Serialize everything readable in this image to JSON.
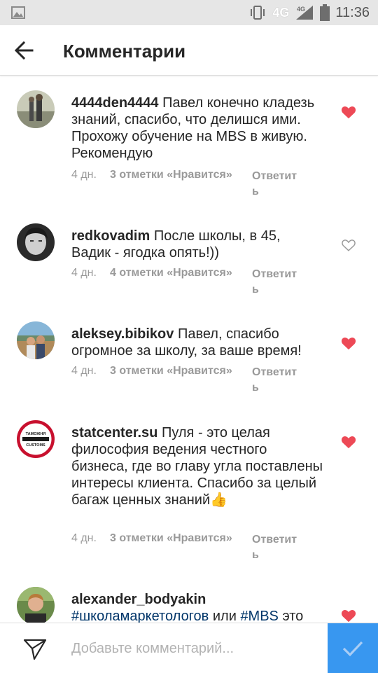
{
  "status_bar": {
    "time": "11:36",
    "network": "4G",
    "network_small": "4G"
  },
  "header": {
    "title": "Комментарии"
  },
  "comments": [
    {
      "username": "4444den4444",
      "text": " Павел конечно кладезь знаний, спасибо, что делишся ими. Прохожу обучение на MBS в живую. Рекомендую",
      "ago": "4 дн.",
      "likes": "3 отметки «Нравится»",
      "reply": "Ответить",
      "liked": true
    },
    {
      "username": "redkovadim",
      "text": " После школы, в 45, Вадик - ягодка опять!))",
      "ago": "4 дн.",
      "likes": "4 отметки «Нравится»",
      "reply": "Ответить",
      "liked": false
    },
    {
      "username": "aleksey.bibikov",
      "text": " Павел, спасибо огромное за школу, за ваше время!",
      "ago": "4 дн.",
      "likes": "3 отметки «Нравится»",
      "reply": "Ответить",
      "liked": true
    },
    {
      "username": "statcenter.su",
      "text": " Пуля - это целая философия ведения честного бизнеса, где во главу угла поставлены интересы клиента. Спасибо за целый багаж ценных знаний",
      "emoji": "👍",
      "ago": "4 дн.",
      "likes": "3 отметки «Нравится»",
      "reply": "Ответить",
      "liked": true
    },
    {
      "username": "alexander_bodyakin",
      "hashtag1": "#школамаркетологов",
      "text_mid": " или ",
      "hashtag2": "#MBS",
      "text_end": " это",
      "liked": true
    }
  ],
  "stamp_text": {
    "top": "ТАМОЖНЯ",
    "bottom": "CUSTOMS"
  },
  "composer": {
    "placeholder": "Добавьте комментарий..."
  },
  "colors": {
    "heart_active": "#ed4956",
    "heart_inactive": "#999999",
    "accent": "#3897f0",
    "hashtag": "#003569"
  },
  "icons": {
    "back": "arrow-left-icon",
    "like": "heart-icon",
    "send": "paper-plane-icon",
    "post": "check-icon"
  }
}
